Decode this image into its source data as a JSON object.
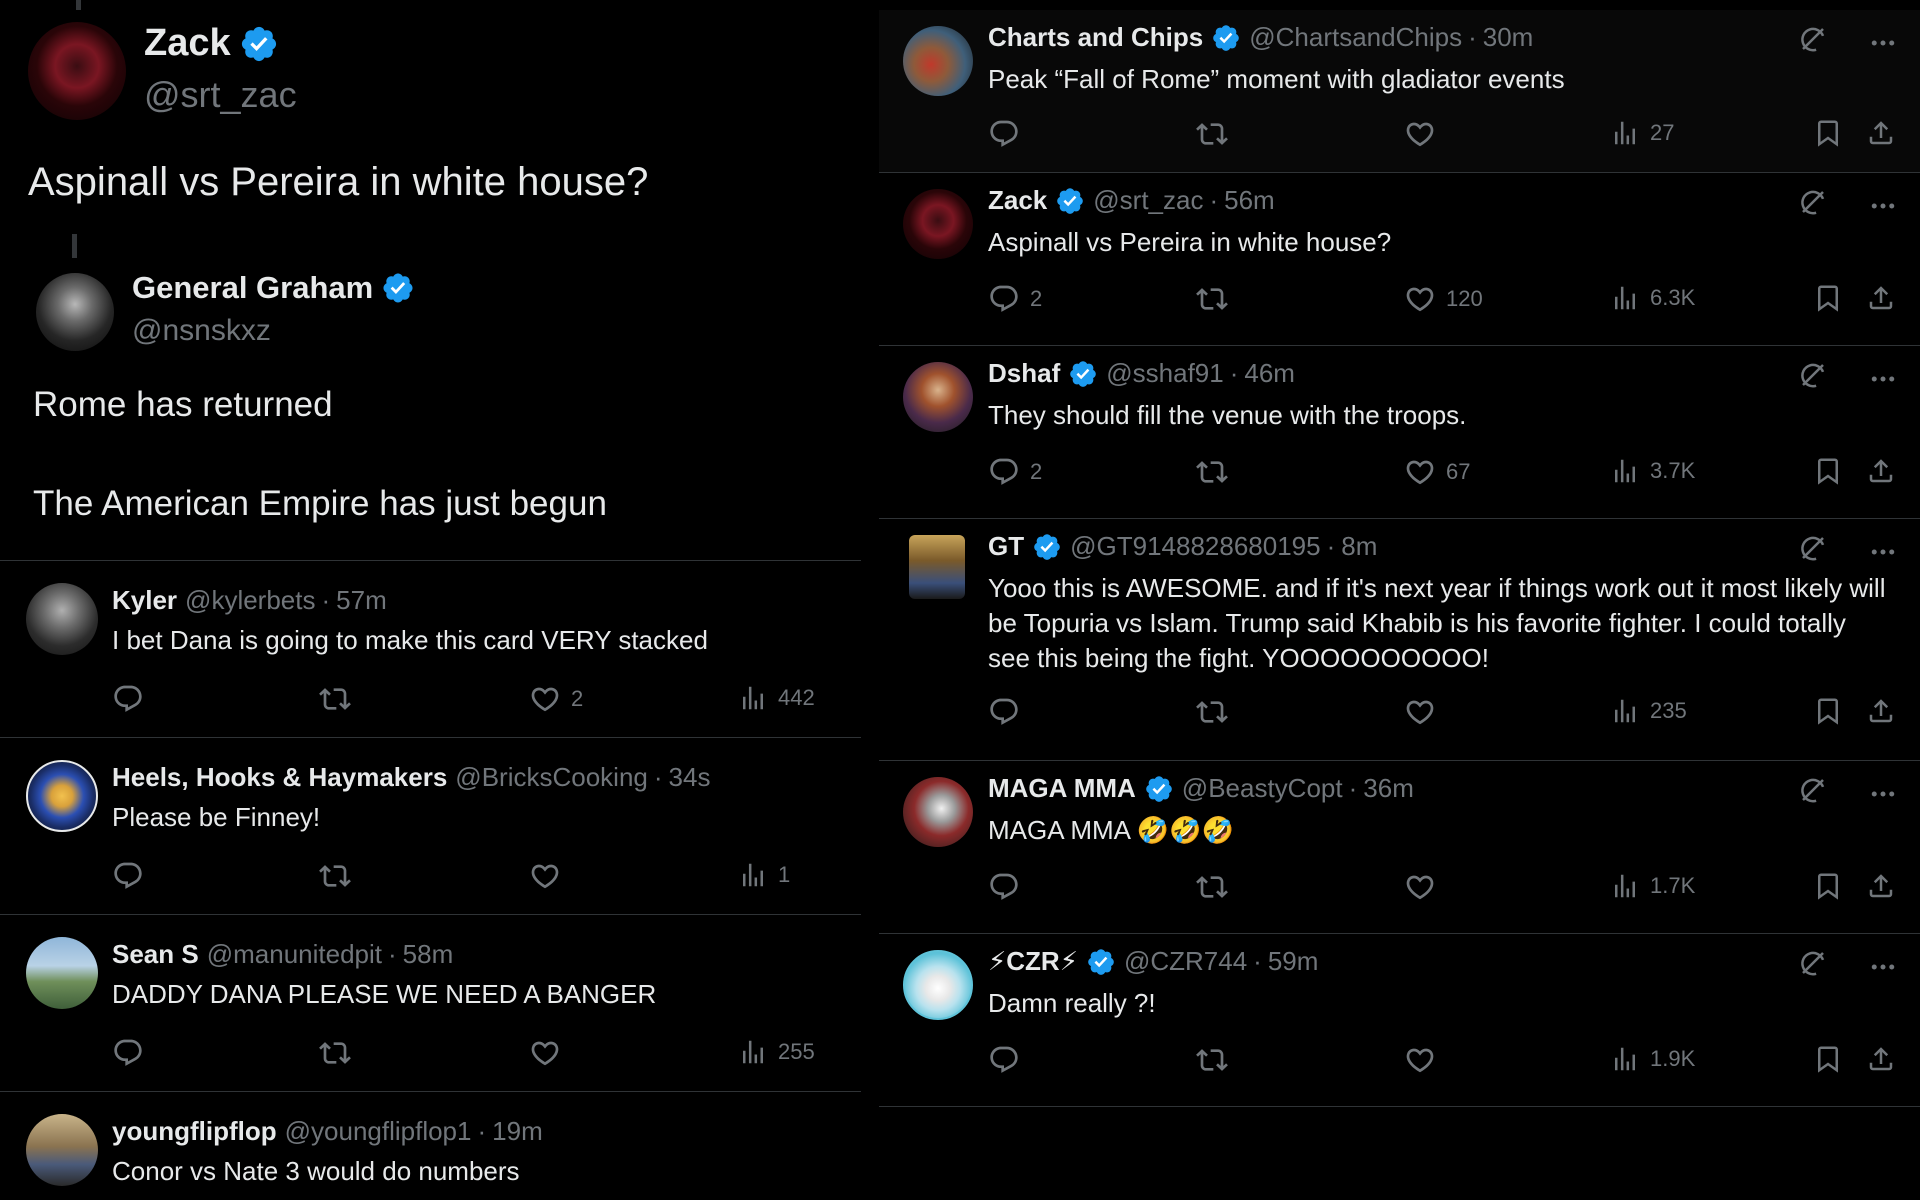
{
  "left": {
    "main_post": {
      "name": "Zack",
      "handle": "@srt_zac",
      "text": "Aspinall vs Pereira in white house?"
    },
    "quoted_post": {
      "name": "General Graham",
      "handle": "@nsnskxz",
      "line1": "Rome has returned",
      "line2": "The American Empire has just begun"
    },
    "replies": [
      {
        "name": "Kyler",
        "handle": "@kylerbets",
        "dot": "·",
        "time": "57m",
        "text": "I bet Dana is going to make this card VERY stacked",
        "reply_count": "",
        "like_count": "2",
        "views": "442"
      },
      {
        "name": "Heels, Hooks & Haymakers",
        "handle": "@BricksCooking",
        "dot": "·",
        "time": "34s",
        "text": "Please be Finney!",
        "reply_count": "",
        "like_count": "",
        "views": "1"
      },
      {
        "name": "Sean S",
        "handle": "@manunitedpit",
        "dot": "·",
        "time": "58m",
        "text": "DADDY DANA PLEASE WE NEED A BANGER",
        "reply_count": "",
        "like_count": "",
        "views": "255"
      },
      {
        "name": "youngflipflop",
        "handle": "@youngflipflop1",
        "dot": "·",
        "time": "19m",
        "text": "Conor vs Nate 3 would do numbers"
      }
    ]
  },
  "right": {
    "tweets": [
      {
        "name": "Charts and Chips",
        "handle": "@ChartsandChips",
        "dot": "·",
        "time": "30m",
        "text": "Peak “Fall of Rome” moment with gladiator events",
        "reply_count": "",
        "like_count": "",
        "views": "27"
      },
      {
        "name": "Zack",
        "handle": "@srt_zac",
        "dot": "·",
        "time": "56m",
        "text": "Aspinall vs Pereira in white house?",
        "reply_count": "2",
        "like_count": "120",
        "views": "6.3K"
      },
      {
        "name": "Dshaf",
        "handle": "@sshaf91",
        "dot": "·",
        "time": "46m",
        "text": "They should fill the venue with the troops.",
        "reply_count": "2",
        "like_count": "67",
        "views": "3.7K"
      },
      {
        "name": "GT",
        "handle": "@GT9148828680195",
        "dot": "·",
        "time": "8m",
        "text": "Yooo this is AWESOME. and if it's next year if things work out it most likely will be Topuria vs Islam. Trump said Khabib is his favorite fighter. I could totally see this being the fight. YOOOOOOOOOO!",
        "reply_count": "",
        "like_count": "",
        "views": "235"
      },
      {
        "name": "MAGA MMA",
        "handle": "@BeastyCopt",
        "dot": "·",
        "time": "36m",
        "text": "MAGA MMA 🤣🤣🤣",
        "reply_count": "",
        "like_count": "",
        "views": "1.7K"
      },
      {
        "name": "⚡CZR⚡",
        "handle": "@CZR744",
        "dot": "·",
        "time": "59m",
        "text": "Damn really ?!",
        "reply_count": "",
        "like_count": "",
        "views": "1.9K"
      }
    ]
  },
  "icons": {
    "verified": "verified-badge-icon",
    "reply": "reply-icon",
    "repost": "repost-icon",
    "like": "like-icon",
    "views": "views-icon",
    "bookmark": "bookmark-icon",
    "share": "share-icon",
    "grok": "grok-icon",
    "more": "more-icon"
  },
  "colors": {
    "background": "#000000",
    "text": "#e7e9ea",
    "muted": "#71767b",
    "divider": "#2f3336",
    "verified": "#1d9bf0"
  }
}
